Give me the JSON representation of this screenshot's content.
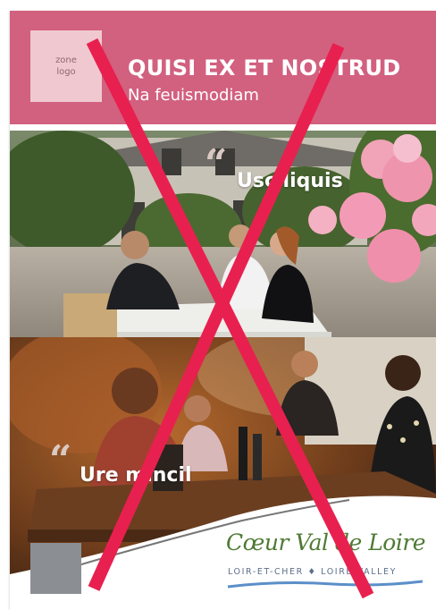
{
  "colors": {
    "brand_pink": "#d2607f",
    "logo_pink": "#efc9cf",
    "cross_red": "#e8204f",
    "brand_green": "#4e7a34",
    "brand_blue": "#5d6f8a",
    "gray_square": "#8b8f94"
  },
  "logo_placeholder": {
    "line1": "zone",
    "line2": "logo"
  },
  "header": {
    "title": "QUISI EX ET NOSTRUD",
    "subtitle": "Na feuismodiam"
  },
  "quotes": [
    {
      "mark": "“",
      "text": "Usciliquis"
    },
    {
      "mark": "“",
      "text": "Ure mincil"
    }
  ],
  "brand": {
    "script": "Cœur Val de Loire",
    "tagline": "LOIR-ET-CHER ♦ LOIRE VALLEY"
  },
  "icons": [
    "quote-icon",
    "cross-out-mark"
  ]
}
